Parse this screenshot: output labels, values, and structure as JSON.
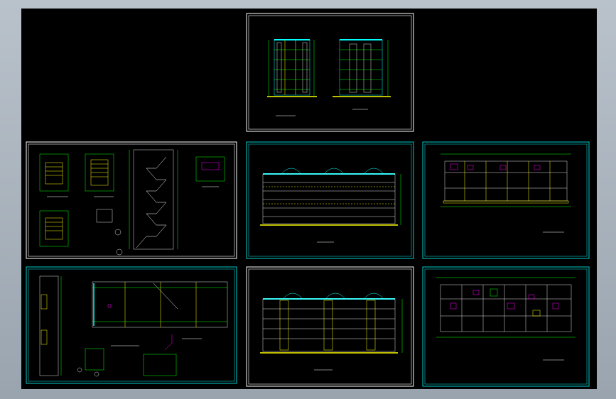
{
  "window": {
    "background": "#a9b3bd"
  },
  "canvas": {
    "background": "#000000"
  },
  "colors": {
    "frame_white": "#ffffff",
    "frame_cyan": "#00cccc",
    "line_cyan": "#00ffff",
    "line_green": "#00ff00",
    "line_yellow": "#ffff00",
    "line_magenta": "#ff00ff",
    "line_white": "#e0e0e0"
  },
  "sheets": [
    {
      "id": "elevation-sections",
      "kind": "elevation-pair"
    },
    {
      "id": "stair-details",
      "kind": "details"
    },
    {
      "id": "rear-elevation",
      "kind": "elevation"
    },
    {
      "id": "floor-plan-1",
      "kind": "plan"
    },
    {
      "id": "wall-details",
      "kind": "details-plan"
    },
    {
      "id": "front-elevation",
      "kind": "elevation"
    },
    {
      "id": "floor-plan-2",
      "kind": "plan"
    }
  ]
}
